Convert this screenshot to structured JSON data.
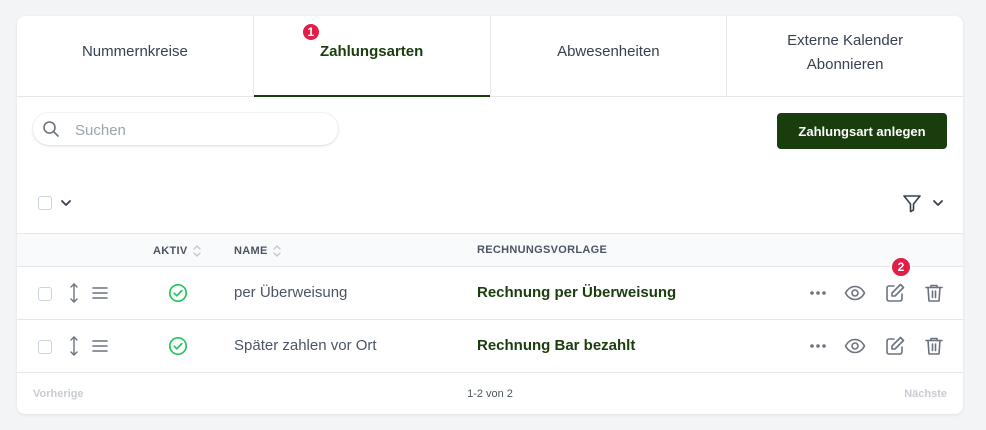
{
  "tabs": [
    {
      "label": "Nummernkreise",
      "active": false
    },
    {
      "label": "Zahlungsarten",
      "active": true,
      "badge": "1"
    },
    {
      "label": "Abwesenheiten",
      "active": false
    },
    {
      "label": "Externe Kalender Abonnieren",
      "active": false
    }
  ],
  "search": {
    "placeholder": "Suchen",
    "value": ""
  },
  "toolbar": {
    "create_label": "Zahlungsart anlegen"
  },
  "table": {
    "columns": [
      "AKTIV",
      "NAME",
      "RECHNUNGSVORLAGE"
    ],
    "rows": [
      {
        "active": true,
        "name": "per Überweisung",
        "template": "Rechnung per Überweisung",
        "edit_badge": "2"
      },
      {
        "active": true,
        "name": "Später zahlen vor Ort",
        "template": "Rechnung Bar bezahlt"
      }
    ]
  },
  "pagination": {
    "prev_label": "Vorherige",
    "info": "1-2 von 2",
    "next_label": "Nächste"
  },
  "colors": {
    "brand": "#1a3d0d",
    "badge": "#e11d48",
    "active_check": "#22c55e"
  },
  "icons": [
    "search-icon",
    "chevron-down-icon",
    "filter-icon",
    "sort-icon",
    "move-vertical-icon",
    "drag-handle-icon",
    "check-circle-icon",
    "more-icon",
    "eye-icon",
    "edit-icon",
    "trash-icon"
  ]
}
